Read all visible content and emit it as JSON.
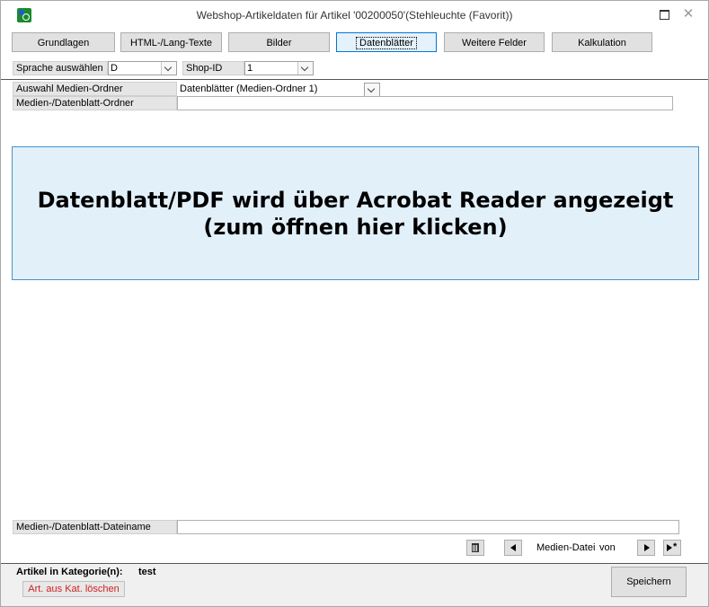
{
  "window": {
    "title": "Webshop-Artikeldaten für Artikel '00200050'(Stehleuchte  (Favorit))",
    "close": "✕"
  },
  "tabs": [
    {
      "label": "Grundlagen"
    },
    {
      "label": "HTML-/Lang-Texte"
    },
    {
      "label": "Bilder"
    },
    {
      "label": "Datenblätter"
    },
    {
      "label": "Weitere Felder"
    },
    {
      "label": "Kalkulation"
    }
  ],
  "language": {
    "label": "Sprache auswählen",
    "value": "D"
  },
  "shop": {
    "label": "Shop-ID",
    "value": "1"
  },
  "media_folder": {
    "label": "Auswahl Medien-Ordner",
    "value": "Datenblätter (Medien-Ordner 1)"
  },
  "media_path": {
    "label": "Medien-/Datenblatt-Ordner",
    "value": ""
  },
  "pdf_panel": {
    "line1": "Datenblatt/PDF wird über Acrobat Reader angezeigt",
    "line2": "(zum öffnen hier klicken)"
  },
  "media_filename": {
    "label": "Medien-/Datenblatt-Dateiname",
    "value": ""
  },
  "navigation": {
    "label": "Medien-Datei",
    "von": "von"
  },
  "footer": {
    "category_label": "Artikel in Kategorie(n):",
    "category_value": "test",
    "delete_label": "Art. aus Kat. löschen",
    "save_label": "Speichern"
  }
}
